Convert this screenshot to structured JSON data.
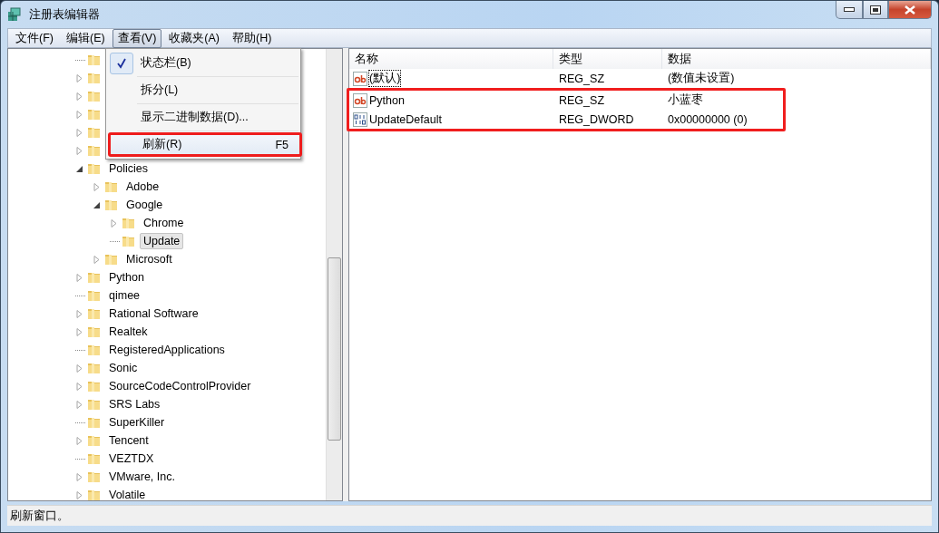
{
  "window": {
    "title": "注册表编辑器"
  },
  "menu_bar": [
    {
      "label": "文件(F)",
      "selected": false
    },
    {
      "label": "编辑(E)",
      "selected": false
    },
    {
      "label": "查看(V)",
      "selected": true
    },
    {
      "label": "收藏夹(A)",
      "selected": false
    },
    {
      "label": "帮助(H)",
      "selected": false
    }
  ],
  "view_menu": [
    {
      "label": "状态栏(B)",
      "checked": true,
      "highlighted": false,
      "annotated": false
    },
    {
      "label": "拆分(L)",
      "checked": false,
      "highlighted": false,
      "annotated": false
    },
    {
      "label": "显示二进制数据(D)...",
      "checked": false,
      "highlighted": false,
      "annotated": false
    },
    {
      "label": "刷新(R)",
      "shortcut": "F5",
      "checked": false,
      "highlighted": true,
      "annotated": true
    }
  ],
  "tree": [
    {
      "expandable": false
    },
    {
      "expandable": true,
      "expanded": false
    },
    {
      "expandable": true,
      "expanded": false
    },
    {
      "expandable": true,
      "expanded": false
    },
    {
      "expandable": true,
      "expanded": false
    },
    {
      "expandable": true,
      "expanded": false
    },
    {
      "name": "Policies",
      "expandable": true,
      "expanded": true,
      "selected": false,
      "children": [
        {
          "name": "Adobe",
          "expandable": true,
          "expanded": false,
          "selected": false
        },
        {
          "name": "Google",
          "expandable": true,
          "expanded": true,
          "selected": false,
          "children": [
            {
              "name": "Chrome",
              "expandable": true,
              "expanded": false,
              "selected": false
            },
            {
              "name": "Update",
              "expandable": false,
              "selected": true
            }
          ]
        },
        {
          "name": "Microsoft",
          "expandable": true,
          "expanded": false,
          "selected": false
        }
      ]
    },
    {
      "name": "Python",
      "expandable": true,
      "expanded": false,
      "selected": false
    },
    {
      "name": "qimee",
      "expandable": false,
      "selected": false
    },
    {
      "name": "Rational Software",
      "expandable": true,
      "expanded": false,
      "selected": false
    },
    {
      "name": "Realtek",
      "expandable": true,
      "expanded": false,
      "selected": false
    },
    {
      "name": "RegisteredApplications",
      "expandable": false,
      "selected": false
    },
    {
      "name": "Sonic",
      "expandable": true,
      "expanded": false,
      "selected": false
    },
    {
      "name": "SourceCodeControlProvider",
      "expandable": true,
      "expanded": false,
      "selected": false
    },
    {
      "name": "SRS Labs",
      "expandable": true,
      "expanded": false,
      "selected": false
    },
    {
      "name": "SuperKiller",
      "expandable": false,
      "selected": false
    },
    {
      "name": "Tencent",
      "expandable": true,
      "expanded": false,
      "selected": false
    },
    {
      "name": "VEZTDX",
      "expandable": false,
      "selected": false
    },
    {
      "name": "VMware, Inc.",
      "expandable": true,
      "expanded": false,
      "selected": false
    },
    {
      "name": "Volatile",
      "expandable": true,
      "expanded": false,
      "selected": false
    }
  ],
  "values": {
    "columns": [
      "名称",
      "类型",
      "数据"
    ],
    "rows": [
      {
        "name": "(默认)",
        "type": "REG_SZ",
        "data": "(数值未设置)",
        "kind": "string",
        "focused": true,
        "annotated": false
      },
      {
        "name": "Python",
        "type": "REG_SZ",
        "data": "小蓝枣",
        "kind": "string",
        "focused": false,
        "annotated": true
      },
      {
        "name": "UpdateDefault",
        "type": "REG_DWORD",
        "data": "0x00000000 (0)",
        "kind": "binary",
        "focused": false,
        "annotated": true
      }
    ]
  },
  "status_bar": "刷新窗口。"
}
